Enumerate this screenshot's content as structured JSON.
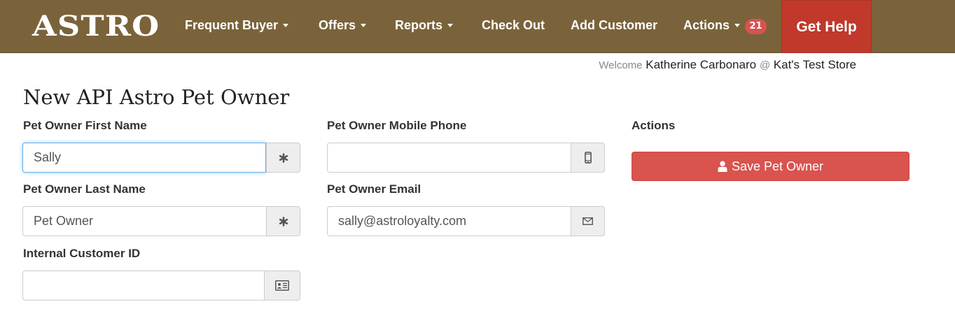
{
  "nav": {
    "logo": "ASTRO",
    "items": [
      {
        "label": "Frequent Buyer",
        "dropdown": true
      },
      {
        "label": "Offers",
        "dropdown": true
      },
      {
        "label": "Reports",
        "dropdown": true
      },
      {
        "label": "Check Out",
        "dropdown": false
      },
      {
        "label": "Add Customer",
        "dropdown": false
      },
      {
        "label": "Actions",
        "dropdown": true
      }
    ],
    "actions_badge": "21",
    "help_label": "Get Help",
    "colors": {
      "bar": "#7a633b",
      "help": "#c0392b",
      "badge": "#d9534f"
    }
  },
  "welcome": {
    "prefix": "Welcome",
    "user": "Katherine Carbonaro",
    "at": "@",
    "store": "Kat's Test Store"
  },
  "page": {
    "title": "New API Astro Pet Owner"
  },
  "form": {
    "first_name": {
      "label": "Pet Owner First Name",
      "value": "Sally",
      "addon_icon": "asterisk-icon"
    },
    "last_name": {
      "label": "Pet Owner Last Name",
      "value": "Pet Owner",
      "addon_icon": "asterisk-icon"
    },
    "customer_id": {
      "label": "Internal Customer ID",
      "value": "",
      "addon_icon": "id-card-icon"
    },
    "mobile_phone": {
      "label": "Pet Owner Mobile Phone",
      "value": "",
      "addon_icon": "mobile-phone-icon"
    },
    "email": {
      "label": "Pet Owner Email",
      "value": "sally@astroloyalty.com",
      "addon_icon": "envelope-icon"
    }
  },
  "actions": {
    "heading": "Actions",
    "save_label": "Save Pet Owner",
    "save_icon": "user-icon",
    "save_color": "#d9534f"
  }
}
